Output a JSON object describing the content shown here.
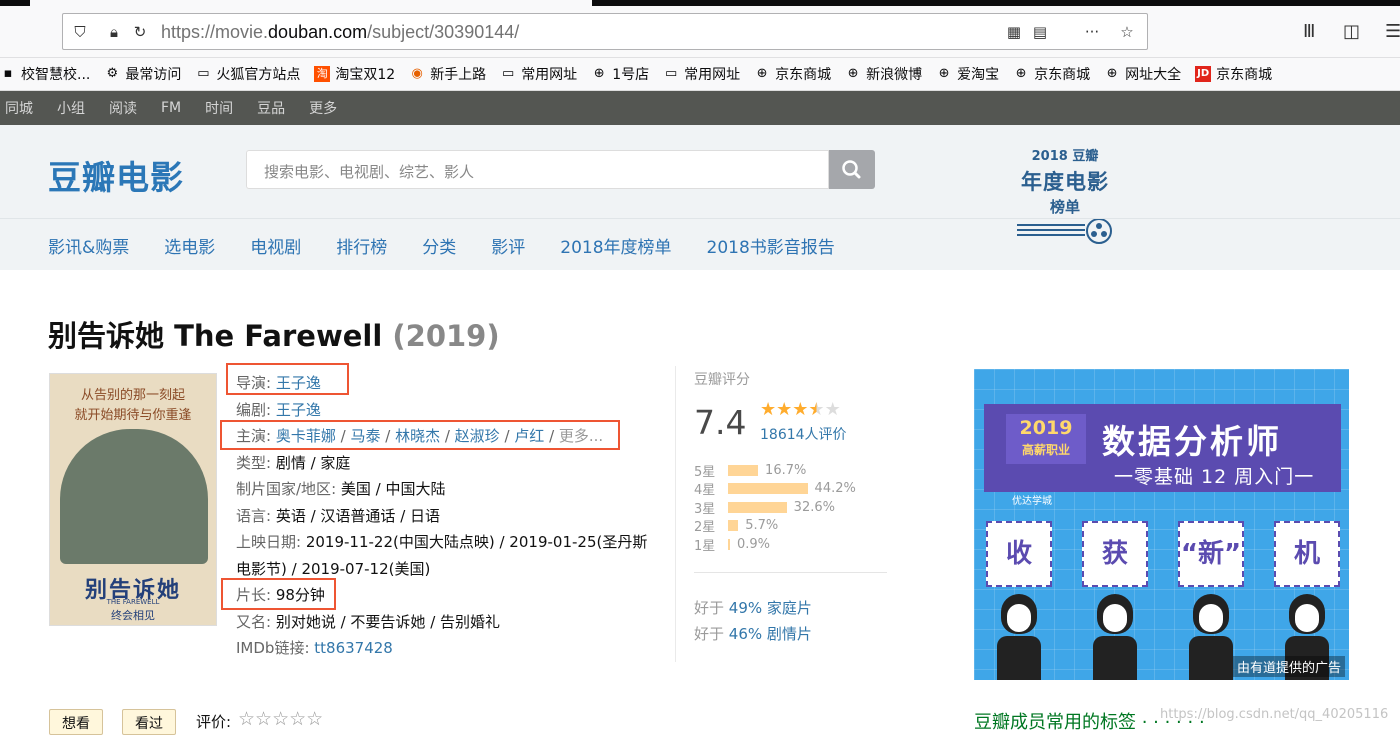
{
  "browser": {
    "url_prefix": "https://movie.",
    "url_domain": "douban.com",
    "url_path": "/subject/30390144/",
    "bookmarks": [
      {
        "icon": "school-icon",
        "label": "校智慧校..."
      },
      {
        "icon": "gear-icon",
        "label": "最常访问"
      },
      {
        "icon": "folder-icon",
        "label": "火狐官方站点"
      },
      {
        "icon": "taobao-icon",
        "label": "淘宝双12"
      },
      {
        "icon": "firefox-icon",
        "label": "新手上路"
      },
      {
        "icon": "folder-icon",
        "label": "常用网址"
      },
      {
        "icon": "globe-icon",
        "label": "1号店"
      },
      {
        "icon": "folder-icon",
        "label": "常用网址"
      },
      {
        "icon": "globe-icon",
        "label": "京东商城"
      },
      {
        "icon": "globe-icon",
        "label": "新浪微博"
      },
      {
        "icon": "globe-icon",
        "label": "爱淘宝"
      },
      {
        "icon": "globe-icon",
        "label": "京东商城"
      },
      {
        "icon": "globe-icon",
        "label": "网址大全"
      },
      {
        "icon": "jd-icon",
        "label": "京东商城"
      }
    ]
  },
  "global_nav": [
    "同城",
    "小组",
    "阅读",
    "FM",
    "时间",
    "豆品",
    "更多"
  ],
  "header": {
    "logo": "豆瓣电影",
    "search_placeholder": "搜索电影、电视剧、综艺、影人",
    "nav": [
      "影讯&购票",
      "选电影",
      "电视剧",
      "排行榜",
      "分类",
      "影评",
      "2018年度榜单",
      "2018书影音报告"
    ],
    "promo": {
      "line1": "2018 豆瓣",
      "line2": "年度电影",
      "line3": "榜单"
    }
  },
  "movie": {
    "title": "别告诉她 The Farewell",
    "year": "(2019)",
    "poster": {
      "top": "从告别的那一刻起",
      "top2": "就开始期待与你重逢",
      "title": "别告诉她",
      "en": "THE FAREWELL",
      "tag": "终会相见"
    },
    "info": {
      "director_label": "导演",
      "director": "王子逸",
      "writer_label": "编剧",
      "writer": "王子逸",
      "cast_label": "主演",
      "cast": [
        "奥卡菲娜",
        "马泰",
        "林晓杰",
        "赵淑珍",
        "卢红"
      ],
      "cast_more": "更多...",
      "genre_label": "类型",
      "genre": "剧情 / 家庭",
      "country_label": "制片国家/地区",
      "country": "美国 / 中国大陆",
      "language_label": "语言",
      "language": "英语 / 汉语普通话 / 日语",
      "release_label": "上映日期",
      "release_line1": "2019-11-22(中国大陆点映) / 2019-01-25(圣丹斯",
      "release_line2": "电影节) / 2019-07-12(美国)",
      "runtime_label": "片长",
      "runtime": "98分钟",
      "aka_label": "又名",
      "aka": "别对她说 / 不要告诉她 / 告别婚礼",
      "imdb_label": "IMDb链接",
      "imdb": "tt8637428"
    },
    "rating": {
      "label": "豆瓣评分",
      "score": "7.4",
      "stars_value": 3.5,
      "votes": "18614人评价",
      "breakdown": [
        {
          "label": "5星",
          "pct": "16.7%",
          "value": 16.7
        },
        {
          "label": "4星",
          "pct": "44.2%",
          "value": 44.2
        },
        {
          "label": "3星",
          "pct": "32.6%",
          "value": 32.6
        },
        {
          "label": "2星",
          "pct": "5.7%",
          "value": 5.7
        },
        {
          "label": "1星",
          "pct": "0.9%",
          "value": 0.9
        }
      ],
      "better_prefix": "好于",
      "better": [
        {
          "pct": "49%",
          "genre": "家庭片"
        },
        {
          "pct": "46%",
          "genre": "剧情片"
        }
      ]
    }
  },
  "ad": {
    "year": "2019",
    "year_sub": "高薪职业",
    "headline": "数据分析师",
    "sub": "一零基础 12 周入门一",
    "brand": "优达学城",
    "cards": [
      "收",
      "获",
      "“新”",
      "机"
    ],
    "note": "由有道提供的广告"
  },
  "actions": {
    "want": "想看",
    "seen": "看过",
    "rate_label": "评价:",
    "rate_stars": "☆☆☆☆☆",
    "tags_heading": "豆瓣成员常用的标签 · · · · · ·",
    "watermark": "https://blog.csdn.net/qq_40205116"
  },
  "colors": {
    "brand_blue": "#2b77b7",
    "link": "#3377aa",
    "highlight_box": "#ee5533",
    "star": "#ffac2d"
  }
}
